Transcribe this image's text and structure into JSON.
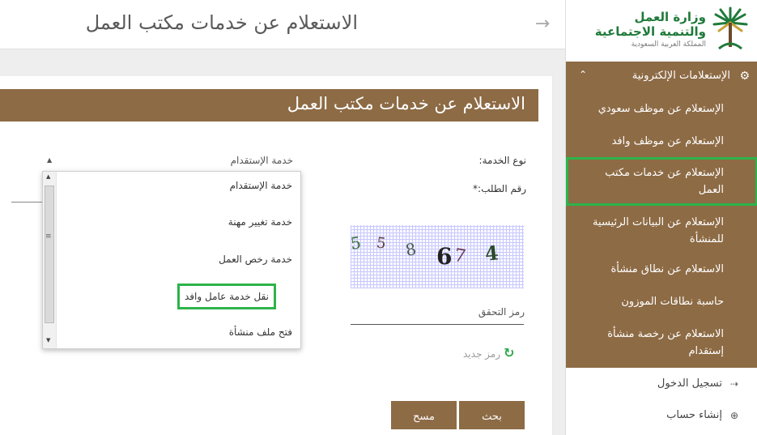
{
  "header": {
    "title": "الاستعلام عن خدمات مكتب العمل"
  },
  "logo": {
    "line1": "وزارة العمل",
    "line2": "والتنمية الاجتماعية",
    "line3": "المملكة العربية السعودية"
  },
  "sidebar": {
    "section_label": "الإستعلامات الإلكترونية",
    "items": [
      {
        "label": "الإستعلام عن موظف سعودي"
      },
      {
        "label": "الإستعلام عن موظف وافد"
      },
      {
        "label": "الإستعلام عن خدمات مكتب العمل"
      },
      {
        "label": "الإستعلام عن البيانات الرئيسية للمنشأة"
      },
      {
        "label": "الاستعلام عن نطاق منشأة"
      },
      {
        "label": "حاسبة نطاقات الموزون"
      },
      {
        "label": "الاستعلام عن رخصة منشأة إستقدام"
      }
    ],
    "login_label": "تسجيل الدخول",
    "register_label": "إنشاء حساب"
  },
  "panel": {
    "title": "الاستعلام عن خدمات مكتب العمل",
    "service_type_label": "نوع الخدمة:",
    "request_number_label": "رقم الطلب:*",
    "service_select_value": "خدمة الإستقدام",
    "captcha_label": "رمز التحقق",
    "new_code_label": "رمز جديد",
    "search_button": "بحث",
    "clear_button": "مسح"
  },
  "dropdown": {
    "options": [
      "خدمة الإستقدام",
      "خدمة تغيير مهنة",
      "خدمة رخص العمل",
      "نقل خدمة عامل وافد",
      "فتح ملف منشأة"
    ]
  },
  "captcha": {
    "chars": [
      "5",
      "5",
      "8",
      "6",
      "7",
      "4"
    ],
    "colors": [
      "#3a6b3a",
      "#5a3a3a",
      "#4a5a4a",
      "#222222",
      "#6a3a5a",
      "#2a4a2a"
    ]
  },
  "colors": {
    "brand_brown": "#8d6b45",
    "highlight_green": "#2db34a"
  }
}
